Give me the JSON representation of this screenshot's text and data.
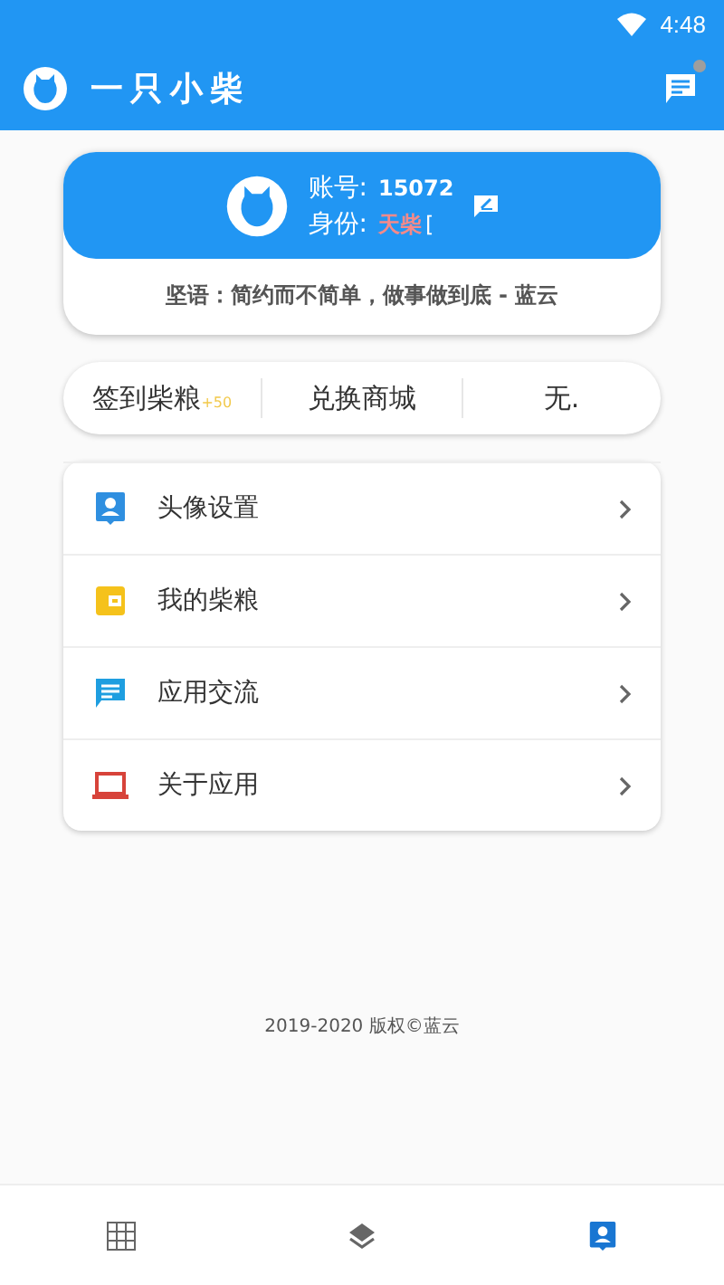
{
  "status_bar": {
    "time": "4:48"
  },
  "app_bar": {
    "title": "一只小柴",
    "has_unread": true
  },
  "profile": {
    "account_label": "账号:",
    "account": "15072",
    "role_label": "身份:",
    "role": "天柴",
    "role_suffix": "[",
    "motto": "坚语：简约而不简单，做事做到底 - 蓝云"
  },
  "actions": [
    {
      "label": "签到柴粮",
      "badge": "+50"
    },
    {
      "label": "兑换商城"
    },
    {
      "label": "无."
    }
  ],
  "menu": [
    {
      "kind": "avatar",
      "label": "头像设置"
    },
    {
      "kind": "wallet",
      "label": "我的柴粮"
    },
    {
      "kind": "chat",
      "label": "应用交流"
    },
    {
      "kind": "laptop",
      "label": "关于应用"
    }
  ],
  "copyright": "2019-2020 版权©蓝云",
  "bottom_nav": [
    {
      "kind": "grid",
      "selected": false
    },
    {
      "kind": "layers",
      "selected": false
    },
    {
      "kind": "person",
      "selected": true
    }
  ]
}
